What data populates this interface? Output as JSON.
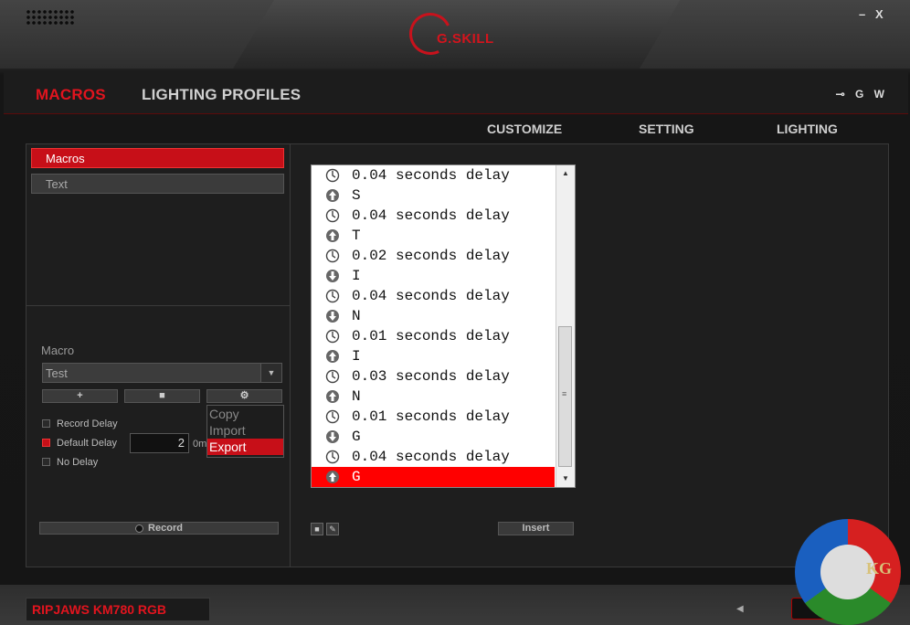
{
  "window": {
    "brand": "G.SKILL",
    "minimize_label": "–",
    "close_label": "X"
  },
  "nav": {
    "tabs": [
      {
        "label": "MACROS",
        "active": true
      },
      {
        "label": "LIGHTING PROFILES",
        "active": false
      }
    ],
    "header_icons": [
      "usb-icon",
      "G",
      "W"
    ],
    "g_label": "G",
    "w_label": "W"
  },
  "subnav": {
    "customize": "CUSTOMIZE",
    "setting": "SETTING",
    "lighting": "LIGHTING"
  },
  "left": {
    "categories": [
      {
        "label": "Macros",
        "selected": true
      },
      {
        "label": "Text",
        "selected": false
      }
    ],
    "macro_label": "Macro",
    "macro_select_value": "Test",
    "add_label": "+",
    "delete_label": "■",
    "settings_label": "⚙",
    "record_delay_label": "Record Delay",
    "record_delay_checked": false,
    "default_delay_label": "Default Delay",
    "default_delay_checked": true,
    "default_delay_value": "2",
    "default_delay_unit": "0m",
    "no_delay_label": "No Delay",
    "no_delay_checked": false,
    "context_menu": {
      "copy": "Copy",
      "import": "Import",
      "export": "Export",
      "highlighted": "Export"
    },
    "record_label": "Record"
  },
  "right": {
    "macro_steps": [
      {
        "type": "delay",
        "text": "0.04 seconds delay"
      },
      {
        "type": "key-up",
        "text": "S"
      },
      {
        "type": "delay",
        "text": "0.04 seconds delay"
      },
      {
        "type": "key-up",
        "text": "T"
      },
      {
        "type": "delay",
        "text": "0.02 seconds delay"
      },
      {
        "type": "key-down",
        "text": "I"
      },
      {
        "type": "delay",
        "text": "0.04 seconds delay"
      },
      {
        "type": "key-down",
        "text": "N"
      },
      {
        "type": "delay",
        "text": "0.01 seconds delay"
      },
      {
        "type": "key-up",
        "text": "I"
      },
      {
        "type": "delay",
        "text": "0.03 seconds delay"
      },
      {
        "type": "key-up",
        "text": "N"
      },
      {
        "type": "delay",
        "text": "0.01 seconds delay"
      },
      {
        "type": "key-down",
        "text": "G"
      },
      {
        "type": "delay",
        "text": "0.04 seconds delay"
      },
      {
        "type": "key-up",
        "text": "G",
        "selected": true
      }
    ],
    "insert_label": "Insert"
  },
  "footer": {
    "device_name": "RIPJAWS KM780 RGB",
    "watermark_text": "KG"
  },
  "colors": {
    "accent": "#e1141e",
    "selection": "#ff0000",
    "panel": "#1e1e1e"
  }
}
